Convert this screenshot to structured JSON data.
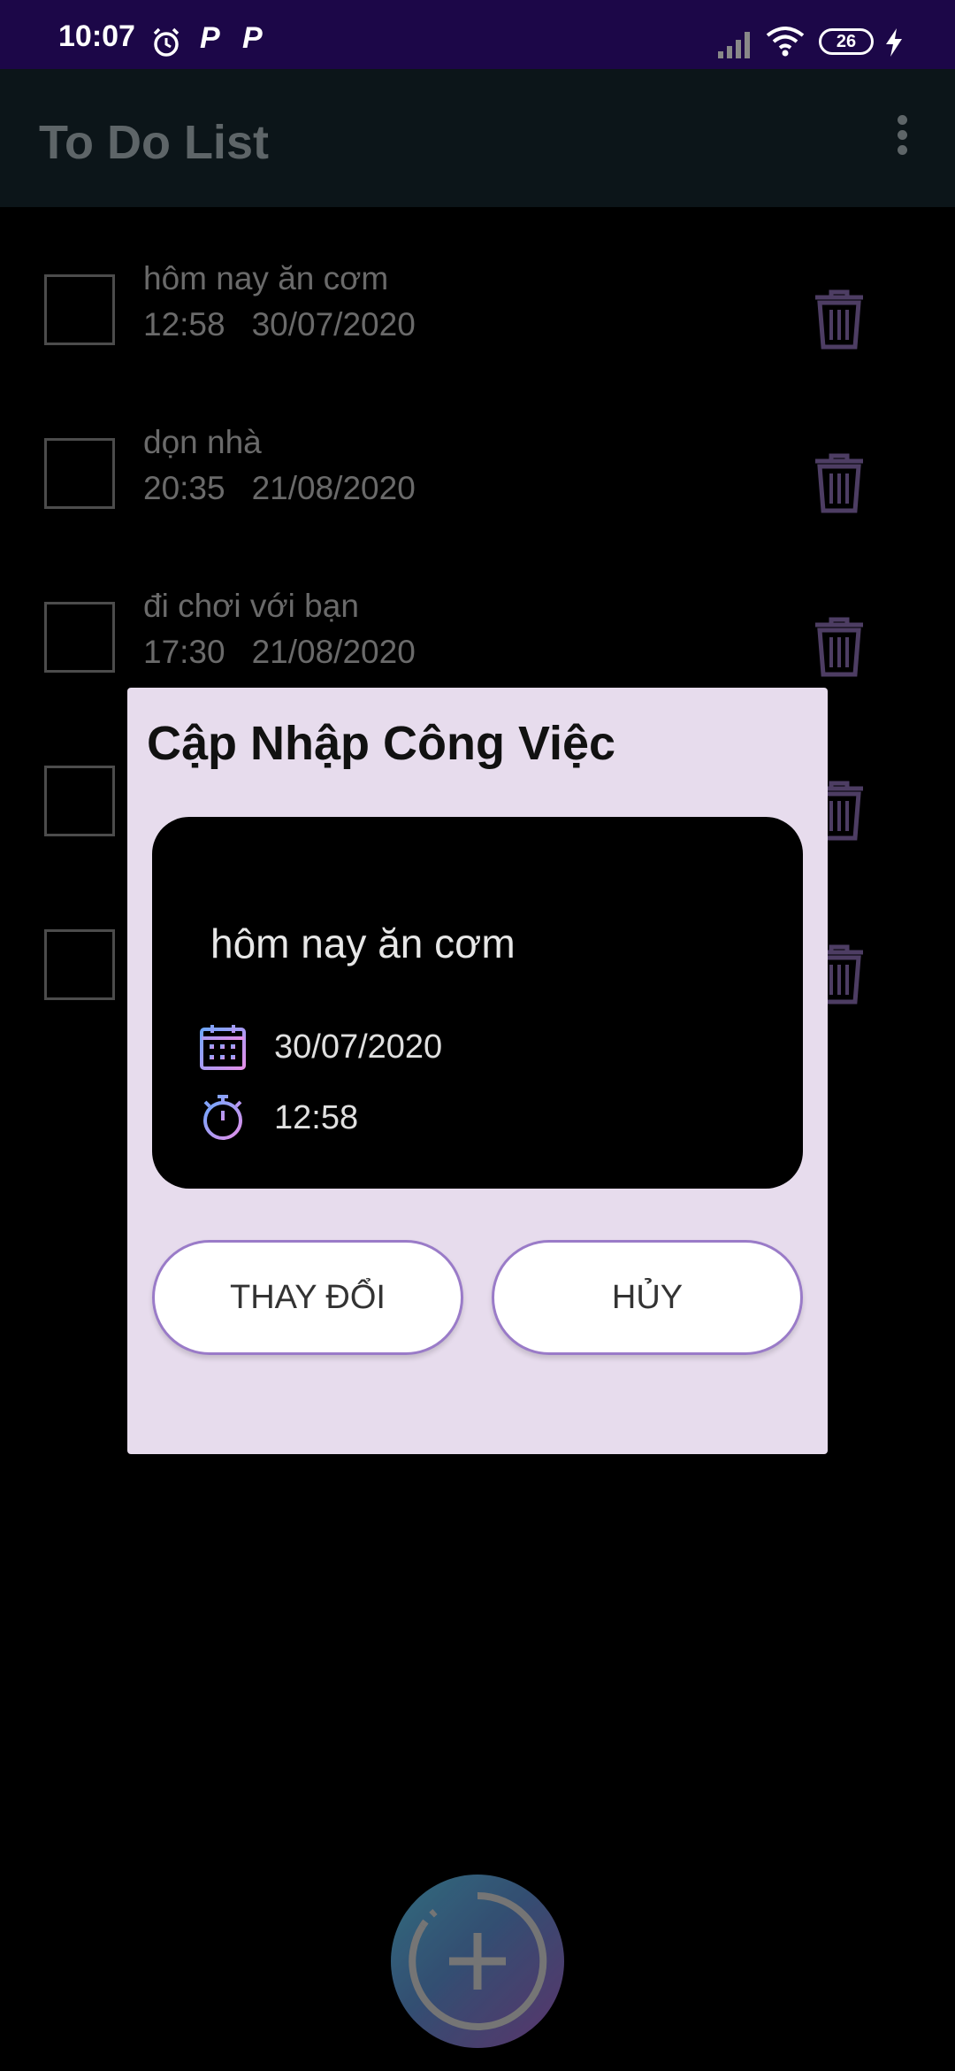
{
  "status_bar": {
    "time": "10:07",
    "notif_1": "P",
    "notif_2": "P",
    "battery": "26"
  },
  "app_bar": {
    "title": "To Do List"
  },
  "tasks": [
    {
      "title": "hôm nay ăn cơm",
      "time": "12:58",
      "date": "30/07/2020"
    },
    {
      "title": "dọn nhà",
      "time": "20:35",
      "date": "21/08/2020"
    },
    {
      "title": "đi chơi với bạn",
      "time": "17:30",
      "date": "21/08/2020"
    },
    {
      "title": "",
      "time": "",
      "date": ""
    },
    {
      "title": "",
      "time": "",
      "date": ""
    }
  ],
  "dialog": {
    "title": "Cập Nhập Công Việc",
    "task": "hôm nay ăn cơm",
    "date": "30/07/2020",
    "time": "12:58",
    "change_label": "THAY ĐỔI",
    "cancel_label": "HỦY"
  }
}
